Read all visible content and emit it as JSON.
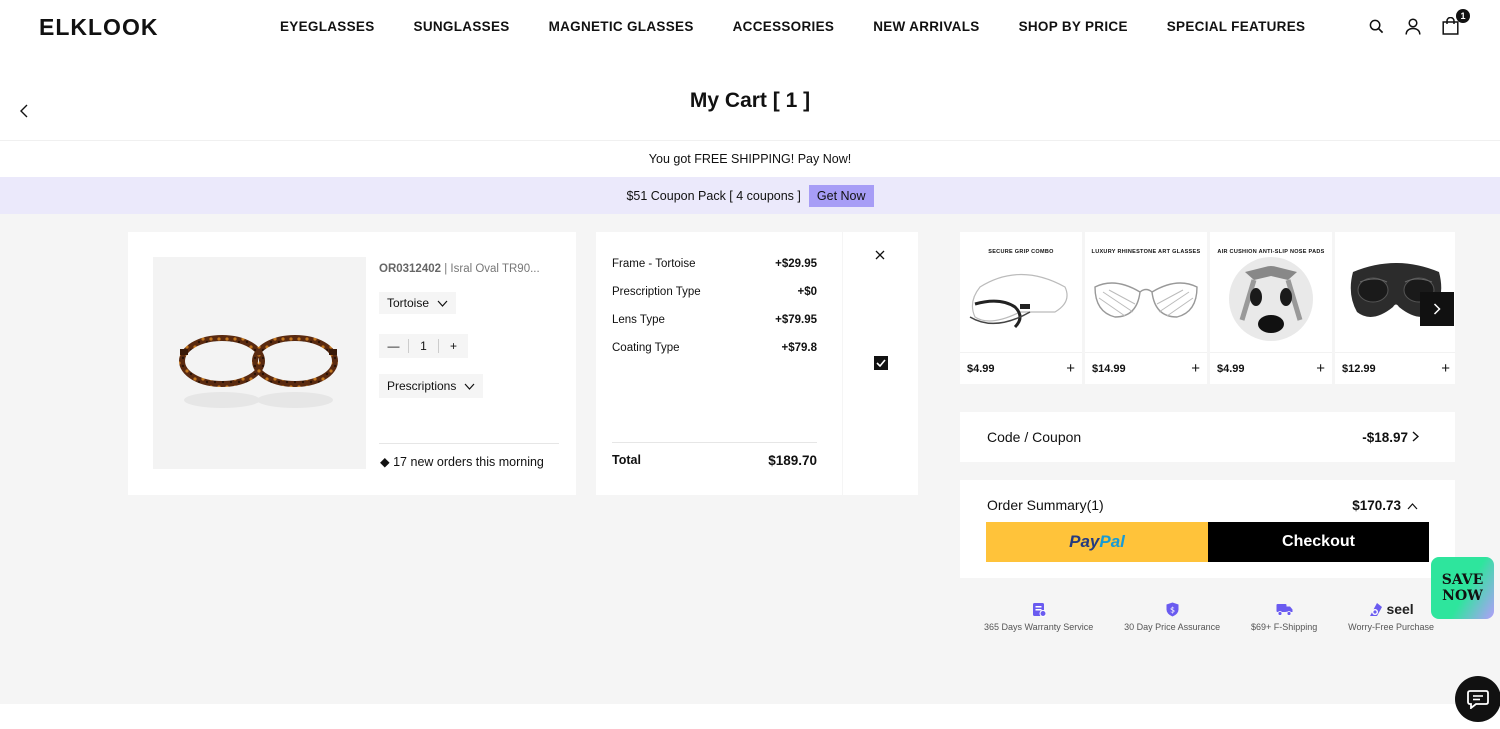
{
  "brand": {
    "logo": "ELKLOOK"
  },
  "nav": [
    "EYEGLASSES",
    "SUNGLASSES",
    "MAGNETIC GLASSES",
    "ACCESSORIES",
    "NEW ARRIVALS",
    "SHOP BY PRICE",
    "SPECIAL FEATURES"
  ],
  "header_icons": {
    "search": "search-icon",
    "account": "user-icon",
    "cart": "shopping-bag-icon",
    "cart_count": "1"
  },
  "page": {
    "title": "My Cart [ 1 ]",
    "shipping_notice": "You got FREE SHIPPING! Pay Now!",
    "coupon_pack": "$51 Coupon Pack [ 4 coupons ]",
    "coupon_cta": "Get Now"
  },
  "cart_item": {
    "sku": "OR0312402",
    "name": "| Isral Oval TR90...",
    "color": "Tortoise",
    "quantity": "1",
    "prescriptions_label": "Prescriptions",
    "social_proof": "17 new orders this morning",
    "selected": true,
    "price_breakdown": [
      {
        "label": "Frame - Tortoise",
        "value": "+$29.95"
      },
      {
        "label": "Prescription Type",
        "value": "+$0"
      },
      {
        "label": "Lens Type",
        "value": "+$79.95"
      },
      {
        "label": "Coating Type",
        "value": "+$79.8"
      }
    ],
    "total_label": "Total",
    "total_value": "$189.70"
  },
  "recommendations": [
    {
      "title": "SECURE GRIP COMBO",
      "price": "$4.99"
    },
    {
      "title": "LUXURY RHINESTONE ART GLASSES",
      "price": "$14.99"
    },
    {
      "title": "AIR CUSHION ANTI-SLIP NOSE PADS",
      "price": "$4.99"
    },
    {
      "title": "",
      "price": "$12.99"
    }
  ],
  "coupon": {
    "label": "Code / Coupon",
    "value": "-$18.97"
  },
  "summary": {
    "label": "Order Summary(1)",
    "value": "$170.73",
    "paypal_pay": "Pay",
    "paypal_pal": "Pal",
    "checkout": "Checkout"
  },
  "features": [
    {
      "icon": "warranty-icon",
      "label": "365 Days Warranty Service"
    },
    {
      "icon": "price-shield-icon",
      "label": "30 Day Price Assurance"
    },
    {
      "icon": "truck-icon",
      "label": "$69+ F-Shipping"
    },
    {
      "icon": "seel-icon",
      "label": "Worry-Free Purchase",
      "brand": "seel"
    }
  ],
  "promo_badge": {
    "line1": "SAVE",
    "line2": "NOW"
  },
  "colors": {
    "accent_purple": "#a79df6",
    "coupon_bg": "#ebe9fb",
    "paypal_yellow": "#ffc33a",
    "save_green": "#2ee59d"
  }
}
